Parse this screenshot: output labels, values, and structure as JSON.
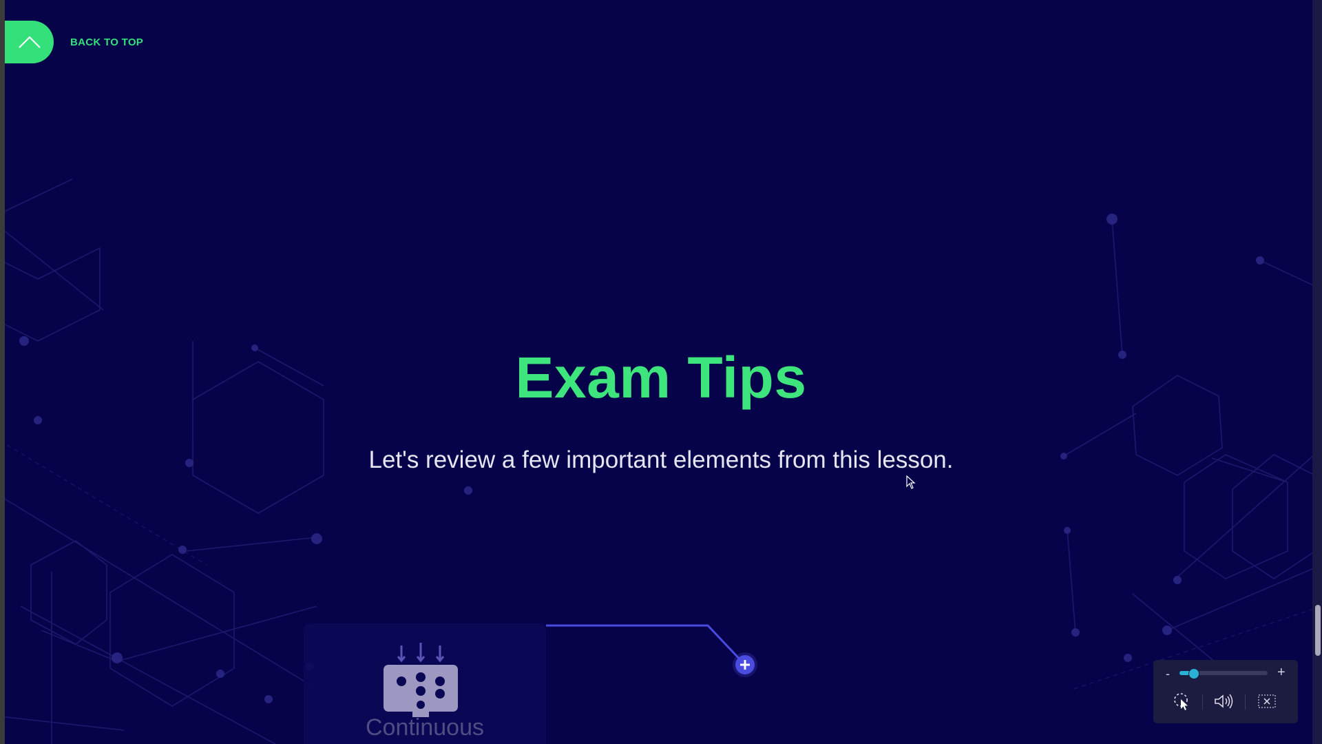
{
  "nav": {
    "back_to_top_label": "BACK TO TOP",
    "back_to_top_icon": "chevron-up-icon"
  },
  "hero": {
    "title": "Exam Tips",
    "subtitle": "Let's review a few important elements from this lesson."
  },
  "cards": [
    {
      "label": "Continuous",
      "icon": "monitor-data-icon"
    }
  ],
  "expand_button": {
    "icon": "plus-icon"
  },
  "accessibility_panel": {
    "zoom_out_label": "-",
    "zoom_in_label": "+",
    "zoom_level": 0.16,
    "icons": [
      "cursor-highlight-icon",
      "speaker-icon",
      "close-icon"
    ]
  },
  "colors": {
    "background": "#07034a",
    "accent_green": "#3ee57c",
    "subtitle": "#e6e6f2",
    "connector": "#4a4be0",
    "panel_bg": "#1b1c40",
    "slider": "#2bb0d6"
  }
}
